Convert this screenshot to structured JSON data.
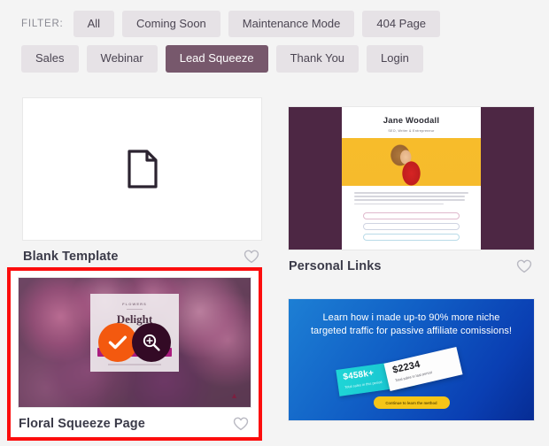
{
  "filter": {
    "label": "FILTER:",
    "row1": [
      {
        "label": "All",
        "active": false
      },
      {
        "label": "Coming Soon",
        "active": false
      },
      {
        "label": "Maintenance Mode",
        "active": false
      },
      {
        "label": "404 Page",
        "active": false
      }
    ],
    "row2": [
      {
        "label": "Sales",
        "active": false
      },
      {
        "label": "Webinar",
        "active": false
      },
      {
        "label": "Lead Squeeze",
        "active": true
      },
      {
        "label": "Thank You",
        "active": false
      },
      {
        "label": "Login",
        "active": false
      }
    ],
    "active_color": "#77586c",
    "inactive_color": "#e6e2e6"
  },
  "templates": [
    {
      "title": "Blank Template",
      "selected": false,
      "favorite": false,
      "thumb_kind": "blank-document-icon"
    },
    {
      "title": "Personal Links",
      "selected": false,
      "favorite": false,
      "thumb_kind": "personal-links-preview",
      "preview": {
        "name": "Jane Woodall",
        "subtitle": "SEO, Writer & Entrepreneur",
        "side_color": "#4d2744",
        "photo_bg_color": "#f7bc2b"
      }
    },
    {
      "title": "Floral Squeeze Page",
      "selected": true,
      "favorite": false,
      "thumb_kind": "floral-squeeze-preview",
      "highlight_color": "#fc0d0d",
      "preview": {
        "kicker": "FLOWERS",
        "headline": "Delight",
        "cta_color": "#a91c7e"
      },
      "overlay_actions": [
        {
          "name": "select",
          "icon": "check-icon",
          "color": "#f3590f"
        },
        {
          "name": "preview",
          "icon": "magnifier-zoom-in-icon",
          "color": "#330a25"
        }
      ]
    },
    {
      "title": "",
      "selected": false,
      "favorite": false,
      "thumb_kind": "affiliate-blue-preview",
      "preview": {
        "headline": "Learn how i made up-to 90% more niche targeted traffic for passive affiliate comissions!",
        "stat1_value": "$458k+",
        "stat1_caption": "Total sales in this period",
        "stat2_value": "$2234",
        "stat2_caption": "Total sales in last period",
        "cta_label": "Continue to learn the method",
        "cta_color": "#f5c518"
      }
    }
  ]
}
